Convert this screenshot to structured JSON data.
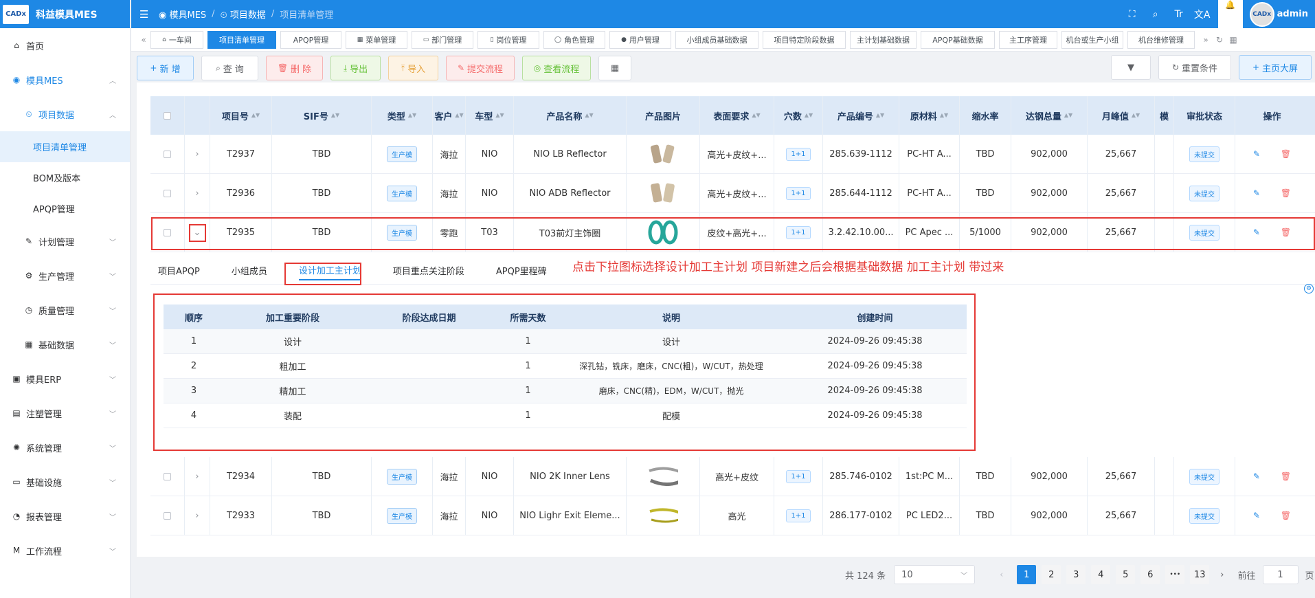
{
  "app": {
    "logo_badge": "CADx",
    "title": "科益模具MES"
  },
  "sidebar": {
    "items": [
      {
        "label": "首页",
        "icon": "home-icon"
      },
      {
        "label": "模具MES",
        "icon": "camera-icon"
      },
      {
        "label": "项目数据",
        "icon": "project-icon"
      },
      {
        "label": "项目清单管理"
      },
      {
        "label": "BOM及版本"
      },
      {
        "label": "APQP管理"
      },
      {
        "label": "计划管理",
        "icon": "edit-icon"
      },
      {
        "label": "生产管理",
        "icon": "factory-icon"
      },
      {
        "label": "质量管理",
        "icon": "clock-icon"
      },
      {
        "label": "基础数据",
        "icon": "calendar-icon"
      },
      {
        "label": "模具ERP",
        "icon": "bag-icon"
      },
      {
        "label": "注塑管理",
        "icon": "box-icon"
      },
      {
        "label": "系统管理",
        "icon": "gear-icon"
      },
      {
        "label": "基础设施",
        "icon": "monitor-icon"
      },
      {
        "label": "报表管理",
        "icon": "report-icon"
      },
      {
        "label": "工作流程",
        "icon": "workflow-icon"
      }
    ]
  },
  "header": {
    "breadcrumb": [
      "模具MES",
      "项目数据",
      "项目清单管理"
    ],
    "user": "admin",
    "avatar_text": "CADx"
  },
  "tabs": [
    "一车间",
    "项目清单管理",
    "APQP管理",
    "菜单管理",
    "部门管理",
    "岗位管理",
    "角色管理",
    "用户管理",
    "小组成员基础数据",
    "项目特定阶段数据",
    "主计划基础数据",
    "APQP基础数据",
    "主工序管理",
    "机台或生产小组",
    "机台维修管理"
  ],
  "toolbar": {
    "add": "新 增",
    "query": "查 询",
    "delete": "删 除",
    "export": "导出",
    "import": "导入",
    "submit_flow": "提交流程",
    "view_flow": "查看流程",
    "reset": "重置条件",
    "big_screen": "主页大屏"
  },
  "table": {
    "headers": [
      "项目号",
      "SIF号",
      "类型",
      "客户",
      "车型",
      "产品名称",
      "产品图片",
      "表面要求",
      "穴数",
      "产品编号",
      "原材料",
      "缩水率",
      "达钢总量",
      "月峰值",
      "模",
      "审批状态",
      "操作"
    ],
    "rows": [
      {
        "project": "T2937",
        "sif": "TBD",
        "type": "生产模",
        "customer": "海拉",
        "model": "NIO",
        "name": "NIO LB Reflector",
        "surface": "高光+皮纹+...",
        "cavity": "1+1",
        "code": "285.639-1112",
        "material": "PC-HT A...",
        "shrink": "TBD",
        "total": "902,000",
        "peak": "25,667",
        "status": "未提交"
      },
      {
        "project": "T2936",
        "sif": "TBD",
        "type": "生产模",
        "customer": "海拉",
        "model": "NIO",
        "name": "NIO ADB Reflector",
        "surface": "高光+皮纹+...",
        "cavity": "1+1",
        "code": "285.644-1112",
        "material": "PC-HT A...",
        "shrink": "TBD",
        "total": "902,000",
        "peak": "25,667",
        "status": "未提交"
      },
      {
        "project": "T2935",
        "sif": "TBD",
        "type": "生产模",
        "customer": "零跑",
        "model": "T03",
        "name": "T03前灯主饰圈",
        "surface": "皮纹+高光+...",
        "cavity": "1+1",
        "code": "3.2.42.10.00...",
        "material": "PC Apec ...",
        "shrink": "5/1000",
        "total": "902,000",
        "peak": "25,667",
        "status": "未提交"
      },
      {
        "project": "T2934",
        "sif": "TBD",
        "type": "生产模",
        "customer": "海拉",
        "model": "NIO",
        "name": "NIO 2K Inner Lens",
        "surface": "高光+皮纹",
        "cavity": "1+1",
        "code": "285.746-0102",
        "material": "1st:PC M...",
        "shrink": "TBD",
        "total": "902,000",
        "peak": "25,667",
        "status": "未提交"
      },
      {
        "project": "T2933",
        "sif": "TBD",
        "type": "生产模",
        "customer": "海拉",
        "model": "NIO",
        "name": "NIO Lighr Exit Eleme...",
        "surface": "高光",
        "cavity": "1+1",
        "code": "286.177-0102",
        "material": "PC LED2...",
        "shrink": "TBD",
        "total": "902,000",
        "peak": "25,667",
        "status": "未提交"
      }
    ]
  },
  "subtabs": [
    "项目APQP",
    "小组成员",
    "设计加工主计划",
    "项目重点关注阶段",
    "APQP里程碑"
  ],
  "annotation": "点击下拉图标选择设计加工主计划 项目新建之后会根据基础数据 加工主计划 带过来",
  "plan_table": {
    "headers": [
      "顺序",
      "加工重要阶段",
      "阶段达成日期",
      "所需天数",
      "说明",
      "创建时间"
    ],
    "rows": [
      [
        "1",
        "设计",
        "",
        "1",
        "设计",
        "2024-09-26 09:45:38"
      ],
      [
        "2",
        "粗加工",
        "",
        "1",
        "深孔钻，铣床，磨床，CNC(粗)，W/CUT，热处理",
        "2024-09-26 09:45:38"
      ],
      [
        "3",
        "精加工",
        "",
        "1",
        "磨床，CNC(精)，EDM，W/CUT，抛光",
        "2024-09-26 09:45:38"
      ],
      [
        "4",
        "装配",
        "",
        "1",
        "配模",
        "2024-09-26 09:45:38"
      ]
    ]
  },
  "pagination": {
    "total": "共 124 条",
    "page_size": "10",
    "pages": [
      "1",
      "2",
      "3",
      "4",
      "5",
      "6",
      "•••",
      "13"
    ],
    "goto_label": "前往",
    "goto_value": "1",
    "page_suffix": "页"
  },
  "colors": {
    "primary": "#1e88e5",
    "danger": "#f56c6c",
    "highlight": "#e53935"
  }
}
